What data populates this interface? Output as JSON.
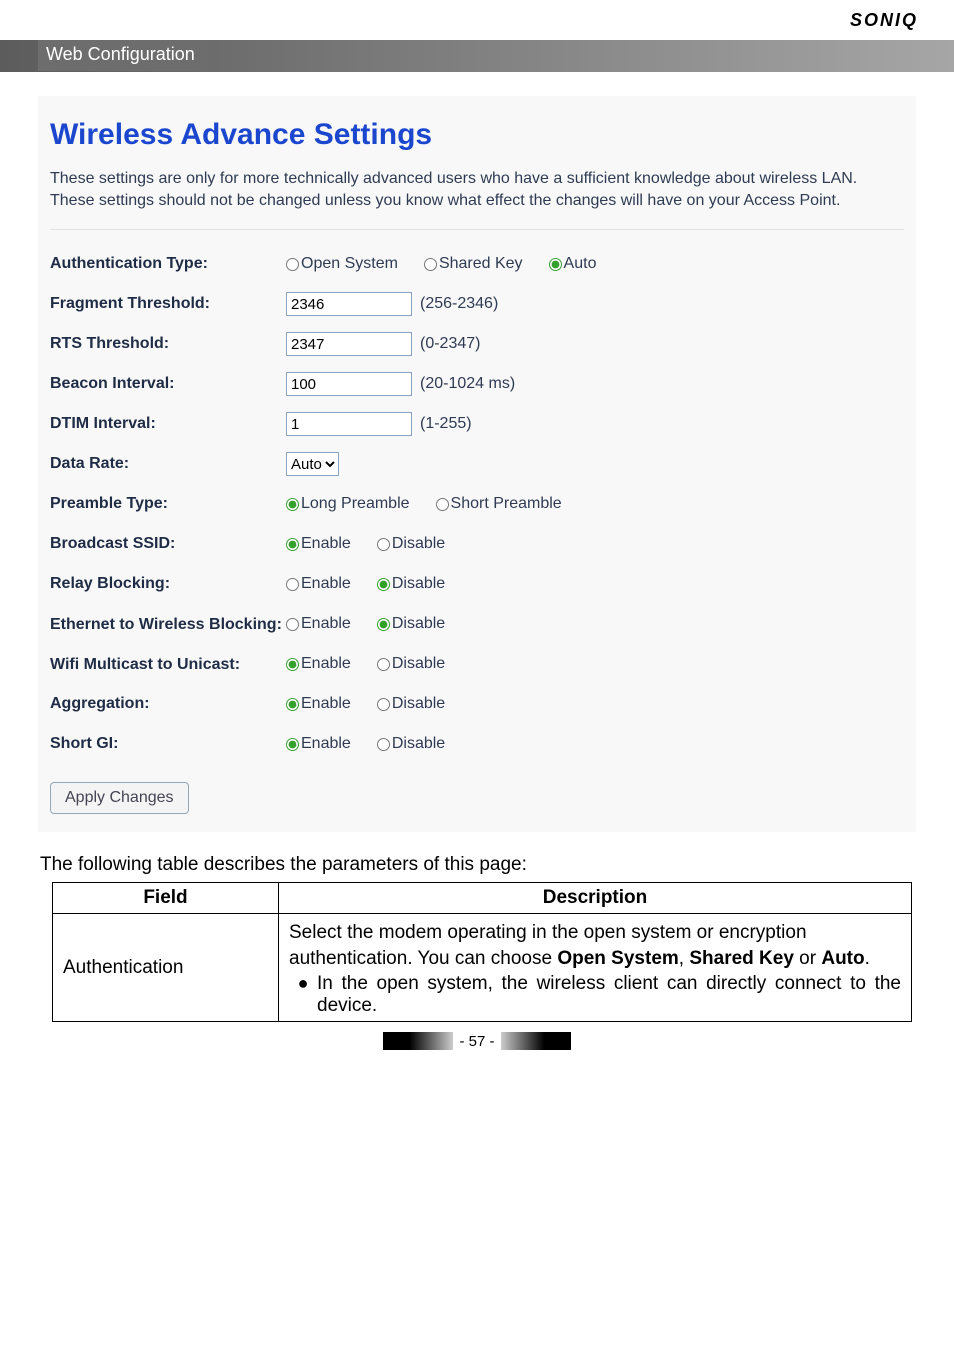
{
  "brand": "SONIQ",
  "tab_label": "Web Configuration",
  "panel": {
    "title": "Wireless Advance Settings",
    "desc": "These settings are only for more technically advanced users who have a sufficient knowledge about wireless LAN. These settings should not be changed unless you know what effect the changes will have on your Access Point."
  },
  "fields": {
    "auth": {
      "label": "Authentication Type:",
      "open": "Open System",
      "shared": "Shared Key",
      "auto": "Auto",
      "selected": "auto"
    },
    "frag": {
      "label": "Fragment Threshold:",
      "value": "2346",
      "range": "(256-2346)"
    },
    "rts": {
      "label": "RTS Threshold:",
      "value": "2347",
      "range": "(0-2347)"
    },
    "beacon": {
      "label": "Beacon Interval:",
      "value": "100",
      "range": "(20-1024 ms)"
    },
    "dtim": {
      "label": "DTIM Interval:",
      "value": "1",
      "range": "(1-255)"
    },
    "rate": {
      "label": "Data Rate:",
      "value": "Auto"
    },
    "preamble": {
      "label": "Preamble Type:",
      "long": "Long Preamble",
      "short": "Short Preamble",
      "selected": "long"
    },
    "bssid": {
      "label": "Broadcast SSID:",
      "enable": "Enable",
      "disable": "Disable",
      "selected": "enable"
    },
    "relay": {
      "label": "Relay Blocking:",
      "enable": "Enable",
      "disable": "Disable",
      "selected": "disable"
    },
    "eth2w": {
      "label": "Ethernet to Wireless Blocking:",
      "enable": "Enable",
      "disable": "Disable",
      "selected": "disable"
    },
    "mcast": {
      "label": "Wifi Multicast to Unicast:",
      "enable": "Enable",
      "disable": "Disable",
      "selected": "enable"
    },
    "aggr": {
      "label": "Aggregation:",
      "enable": "Enable",
      "disable": "Disable",
      "selected": "enable"
    },
    "sgi": {
      "label": "Short GI:",
      "enable": "Enable",
      "disable": "Disable",
      "selected": "enable"
    }
  },
  "apply_btn": "Apply Changes",
  "table_intro": "The following table describes the parameters of this page:",
  "table": {
    "head_field": "Field",
    "head_desc": "Description",
    "row1_field": "Authentication",
    "row1_p1": "Select the modem operating in the open system or encryption authentication. You can choose ",
    "row1_b1": "Open System",
    "row1_comma": ", ",
    "row1_b2": "Shared Key",
    "row1_or": " or ",
    "row1_b3": "Auto",
    "row1_dot": ".",
    "row1_bullet": "In the open system, the wireless client can directly connect to the device."
  },
  "page_number": "- 57 -"
}
